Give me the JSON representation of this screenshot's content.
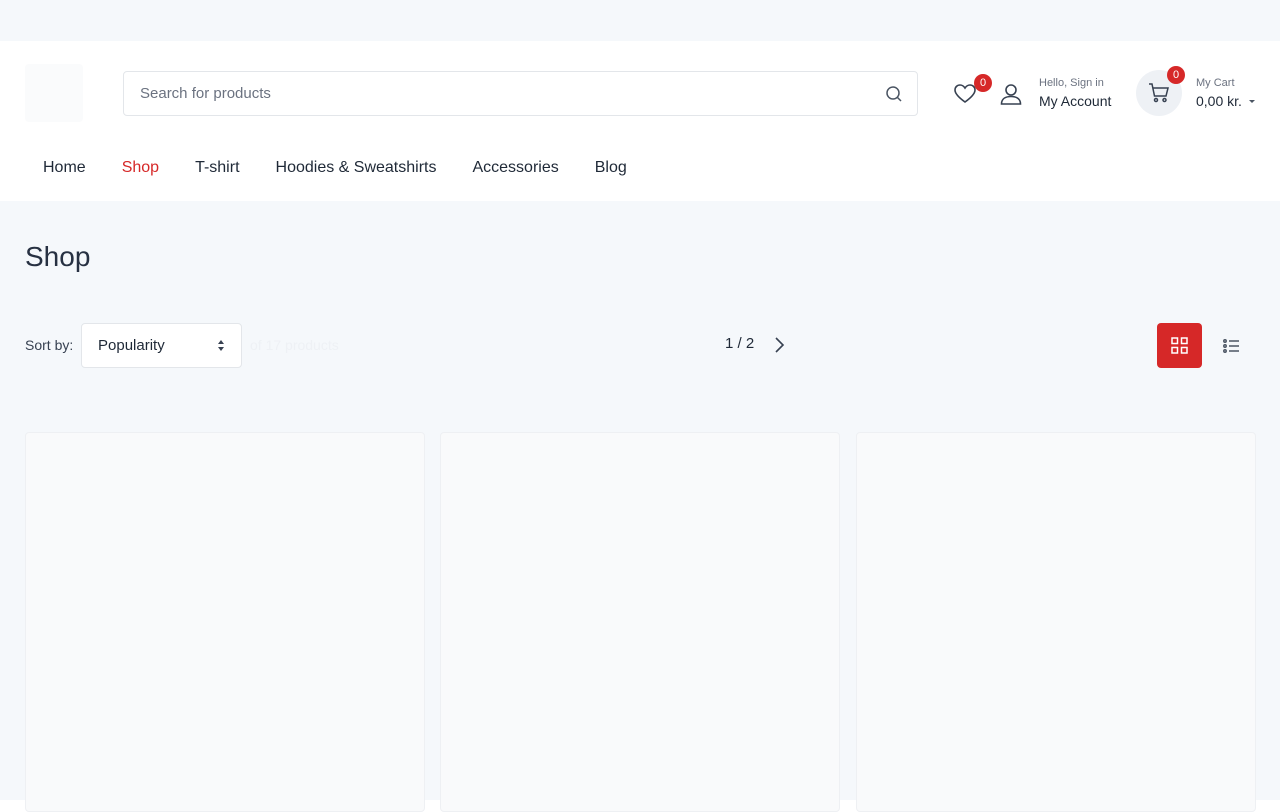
{
  "header": {
    "search": {
      "placeholder": "Search for products"
    },
    "wishlist": {
      "count": "0",
      "icon": "heart-icon"
    },
    "account": {
      "greeting": "Hello, Sign in",
      "label": "My Account",
      "icon": "user-icon"
    },
    "cart": {
      "count": "0",
      "label": "My Cart",
      "total": "0,00 kr.",
      "icon": "cart-icon"
    }
  },
  "nav": {
    "items": [
      {
        "label": "Home"
      },
      {
        "label": "Shop",
        "active": true
      },
      {
        "label": "T-shirt"
      },
      {
        "label": "Hoodies & Sweatshirts"
      },
      {
        "label": "Accessories"
      },
      {
        "label": "Blog"
      }
    ]
  },
  "page": {
    "title": "Shop"
  },
  "toolbar": {
    "sort_label": "Sort by:",
    "sort_value": "Popularity",
    "result_count": "of 17 products",
    "pagination": "1 / 2",
    "view_grid_icon": "grid-icon",
    "view_list_icon": "list-icon"
  },
  "colors": {
    "accent": "#d62828",
    "background": "#f5f8fb",
    "text": "#1f2937"
  }
}
